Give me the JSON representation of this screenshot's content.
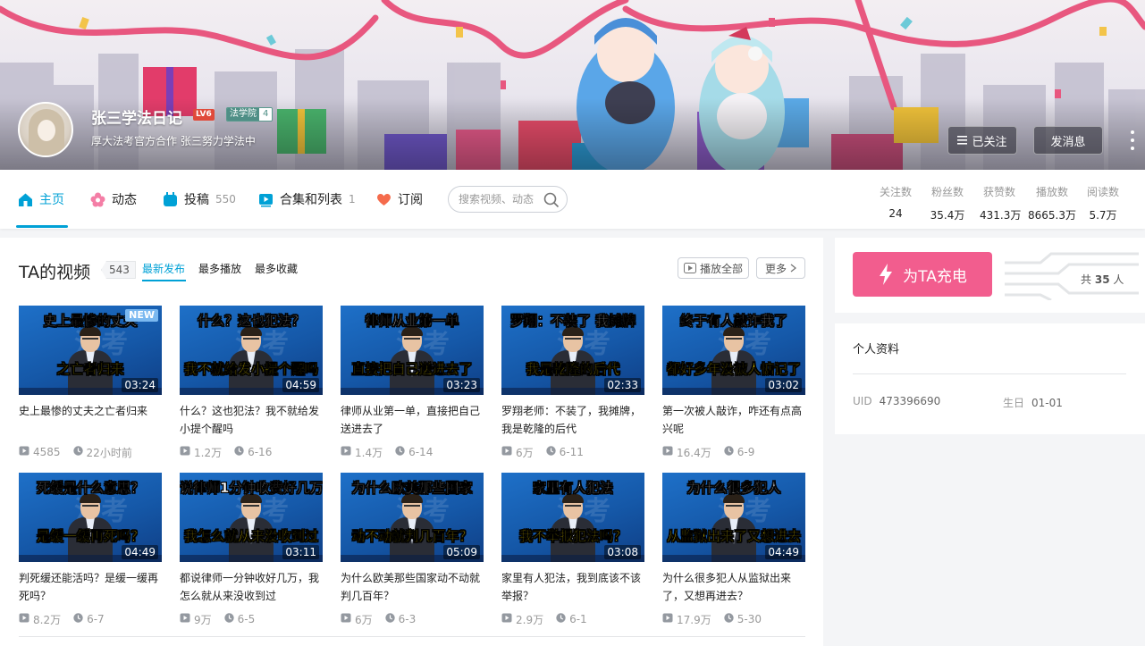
{
  "header": {
    "username": "张三学法日记",
    "level": "LV6",
    "medal_name": "法学院",
    "medal_level": "4",
    "sign": "厚大法考官方合作 张三努力学法中",
    "follow_label": "已关注",
    "message_label": "发消息"
  },
  "nav": {
    "items": [
      {
        "label": "主页",
        "count": "",
        "icon": "home-icon"
      },
      {
        "label": "动态",
        "count": "",
        "icon": "flower-icon"
      },
      {
        "label": "投稿",
        "count": "550",
        "icon": "upload-icon"
      },
      {
        "label": "合集和列表",
        "count": "1",
        "icon": "playlist-icon"
      },
      {
        "label": "订阅",
        "count": "",
        "icon": "heart-icon"
      }
    ],
    "search_placeholder": "搜索视频、动态",
    "stats": [
      {
        "label": "关注数",
        "value": "24"
      },
      {
        "label": "粉丝数",
        "value": "35.4万"
      },
      {
        "label": "获赞数",
        "value": "431.3万"
      },
      {
        "label": "播放数",
        "value": "8665.3万"
      },
      {
        "label": "阅读数",
        "value": "5.7万"
      }
    ]
  },
  "videos_section": {
    "title": "TA的视频",
    "count": "543",
    "tabs": [
      "最新发布",
      "最多播放",
      "最多收藏"
    ],
    "play_all_label": "播放全部",
    "more_label": "更多",
    "items": [
      {
        "caption1": "史上最惨的丈夫",
        "caption2": "之亡者归来",
        "new_badge": "NEW",
        "duration": "03:24",
        "title": "史上最惨的丈夫之亡者归来",
        "plays": "4585",
        "date": "22小时前"
      },
      {
        "caption1": "什么？这也犯法？",
        "caption2": "我不就给发小提个醒吗",
        "duration": "04:59",
        "title": "什么？这也犯法？我不就给发小提个醒吗",
        "plays": "1.2万",
        "date": "6-16"
      },
      {
        "caption1": "律师从业第一单",
        "caption2": "直接把自己送进去了",
        "duration": "03:23",
        "title": "律师从业第一单，直接把自己送进去了",
        "plays": "1.4万",
        "date": "6-14"
      },
      {
        "caption1": "罗翔：不装了 我摊牌",
        "caption2": "我是乾隆的后代",
        "duration": "02:33",
        "title": "罗翔老师：不装了，我摊牌，我是乾隆的后代",
        "plays": "6万",
        "date": "6-11"
      },
      {
        "caption1": "终于有人敲诈我了",
        "caption2": "都好多年没被人惦记了",
        "duration": "03:02",
        "title": "第一次被人敲诈，咋还有点高兴呢",
        "plays": "16.4万",
        "date": "6-9"
      },
      {
        "caption1": "死缓是什么意思？",
        "caption2": "是缓一缓再死吗？",
        "duration": "04:49",
        "title": "判死缓还能活吗？是缓一缓再死吗？",
        "plays": "8.2万",
        "date": "6-7"
      },
      {
        "caption1": "说律师1分钟收费好几万",
        "caption2": "我怎么就从来没收到过",
        "duration": "03:11",
        "title": "都说律师一分钟收好几万，我怎么就从来没收到过",
        "plays": "9万",
        "date": "6-5"
      },
      {
        "caption1": "为什么欧美那些国家",
        "caption2": "动不动就判几百年？",
        "duration": "05:09",
        "title": "为什么欧美那些国家动不动就判几百年？",
        "plays": "6万",
        "date": "6-3"
      },
      {
        "caption1": "家里有人犯法",
        "caption2": "我不举报犯法吗？",
        "duration": "03:08",
        "title": "家里有人犯法，我到底该不该举报？",
        "plays": "2.9万",
        "date": "6-1"
      },
      {
        "caption1": "为什么很多犯人",
        "caption2": "从监狱出来了又想进去",
        "duration": "04:49",
        "title": "为什么很多犯人从监狱出来了，又想再进去？",
        "plays": "17.9万",
        "date": "5-30"
      }
    ]
  },
  "charge": {
    "button_label": "为TA充电",
    "total_prefix": "共",
    "total_value": "35",
    "total_suffix": "人"
  },
  "profile": {
    "title": "个人资料",
    "uid_label": "UID",
    "uid_value": "473396690",
    "birthday_label": "生日",
    "birthday_value": "01-01"
  },
  "colors": {
    "accent": "#00a1d6",
    "charge_pink": "#f25d8e",
    "caption_yellow": "#ffe400",
    "level_red": "#e04a3a"
  }
}
